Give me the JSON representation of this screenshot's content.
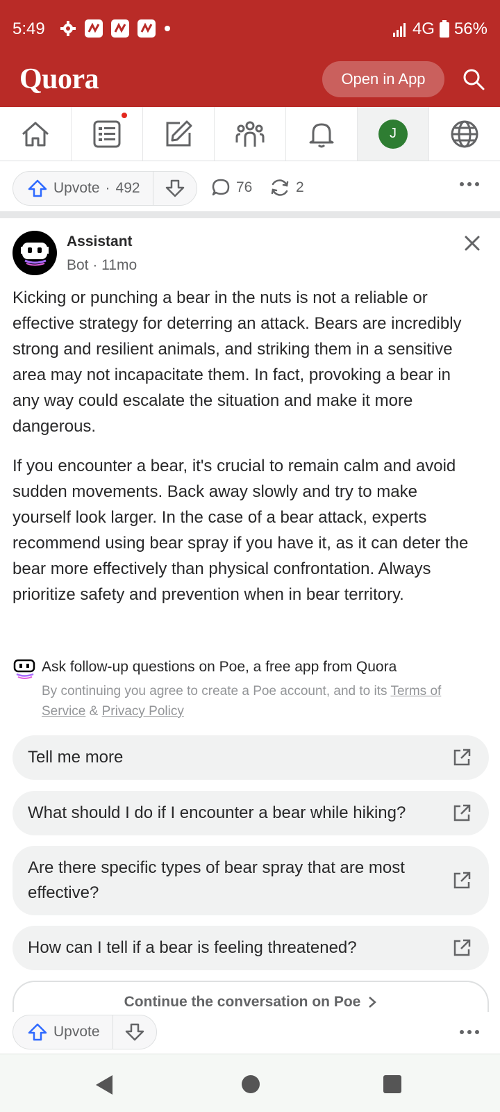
{
  "status_bar": {
    "time": "5:49",
    "network": "4G",
    "battery": "56%",
    "icons": [
      "gear-icon",
      "quora-app-icon",
      "quora-app-icon",
      "quora-app-icon",
      "dot-icon"
    ]
  },
  "header": {
    "logo": "Quora",
    "open_in_app": "Open in App",
    "search_icon": "search-icon"
  },
  "nav": {
    "items": [
      {
        "name": "home",
        "icon": "home-icon"
      },
      {
        "name": "following",
        "icon": "list-icon",
        "badge": true
      },
      {
        "name": "answer",
        "icon": "edit-icon"
      },
      {
        "name": "spaces",
        "icon": "people-icon"
      },
      {
        "name": "notifications",
        "icon": "bell-icon"
      },
      {
        "name": "profile",
        "avatar_letter": "J"
      },
      {
        "name": "language",
        "icon": "globe-icon"
      }
    ]
  },
  "actions": {
    "upvote_label": "Upvote",
    "separator": "·",
    "upvote_count": "492",
    "comments": "76",
    "shares": "2"
  },
  "answer": {
    "author": "Assistant",
    "meta": "Bot · 11mo",
    "paragraphs": [
      "Kicking or punching a bear in the nuts is not a reliable or effective strategy for deterring an attack. Bears are incredibly strong and resilient animals, and striking them in a sensitive area may not incapacitate them. In fact, provoking a bear in any way could escalate the situation and make it more dangerous.",
      "If you encounter a bear, it's crucial to remain calm and avoid sudden movements. Back away slowly and try to make yourself look larger. In the case of a bear attack, experts recommend using bear spray if you have it, as it can deter the bear more effectively than physical confrontation. Always prioritize safety and prevention when in bear territory."
    ]
  },
  "poe": {
    "title": "Ask follow-up questions on Poe, a free app from Quora",
    "note_prefix": "By continuing you agree to create a Poe account, and to its ",
    "terms": "Terms of Service",
    "amp": " & ",
    "privacy": "Privacy Policy",
    "suggestions": [
      "Tell me more",
      "What should I do if I encounter a bear while hiking?",
      "Are there specific types of bear spray that are most effective?",
      "How can I tell if a bear is feeling threatened?"
    ],
    "continue": "Continue the conversation on Poe"
  },
  "bottom": {
    "upvote_label": "Upvote"
  },
  "colors": {
    "brand": "#b92b27",
    "upvote_blue": "#2e69ff",
    "avatar_green": "#2e7d32"
  }
}
